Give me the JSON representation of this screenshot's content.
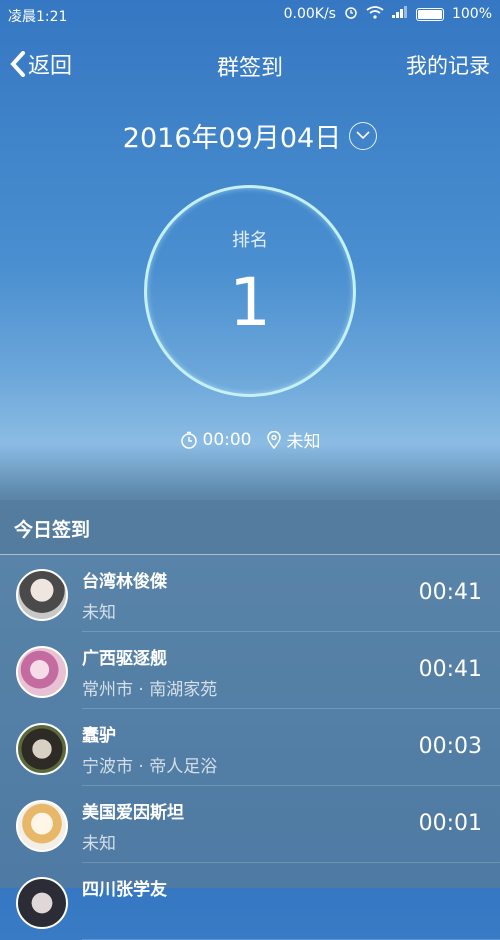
{
  "status": {
    "left": "凌晨1:21",
    "speed": "0.00K/s",
    "battery": "100%"
  },
  "nav": {
    "back_label": "返回",
    "title": "群签到",
    "right_label": "我的记录"
  },
  "date": "2016年09月04日",
  "rank": {
    "label": "排名",
    "value": "1"
  },
  "meta": {
    "time": "00:00",
    "location": "未知"
  },
  "list": {
    "header": "今日签到",
    "rows": [
      {
        "name": "台湾林俊傑",
        "location": "未知",
        "time": "00:41"
      },
      {
        "name": "广西驱逐舰",
        "location": "常州市 · 南湖家苑",
        "time": "00:41"
      },
      {
        "name": "蠢驴",
        "location": "宁波市 · 帝人足浴",
        "time": "00:03"
      },
      {
        "name": "美国爱因斯坦",
        "location": "未知",
        "time": "00:01"
      },
      {
        "name": "四川张学友",
        "location": "",
        "time": ""
      }
    ]
  }
}
